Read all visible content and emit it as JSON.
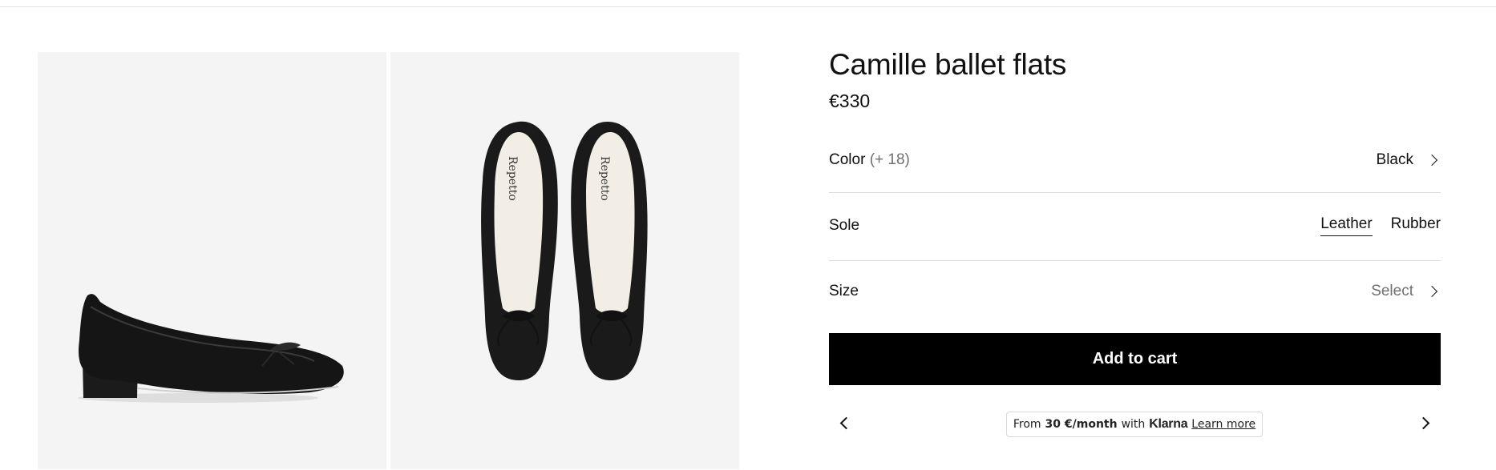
{
  "product": {
    "title": "Camille ballet flats",
    "price": "€330"
  },
  "options": {
    "color": {
      "label": "Color",
      "extra": "(+ 18)",
      "value": "Black"
    },
    "sole": {
      "label": "Sole",
      "choices": [
        "Leather",
        "Rubber"
      ],
      "selected": "Leather"
    },
    "size": {
      "label": "Size",
      "value": "Select"
    }
  },
  "cart": {
    "label": "Add to cart"
  },
  "klarna": {
    "prefix": "From",
    "amount": "30 €/month",
    "middle": "with",
    "brand": "Klarna",
    "link": "Learn more"
  },
  "gallery": {
    "images": [
      "shoe-side-view",
      "shoe-pair-top-view"
    ],
    "brand_print": "Repetto"
  },
  "icons": {
    "color_chevron": "chevron-right-icon",
    "size_chevron": "chevron-right-icon",
    "prev": "chevron-left-icon",
    "next": "chevron-right-icon"
  }
}
